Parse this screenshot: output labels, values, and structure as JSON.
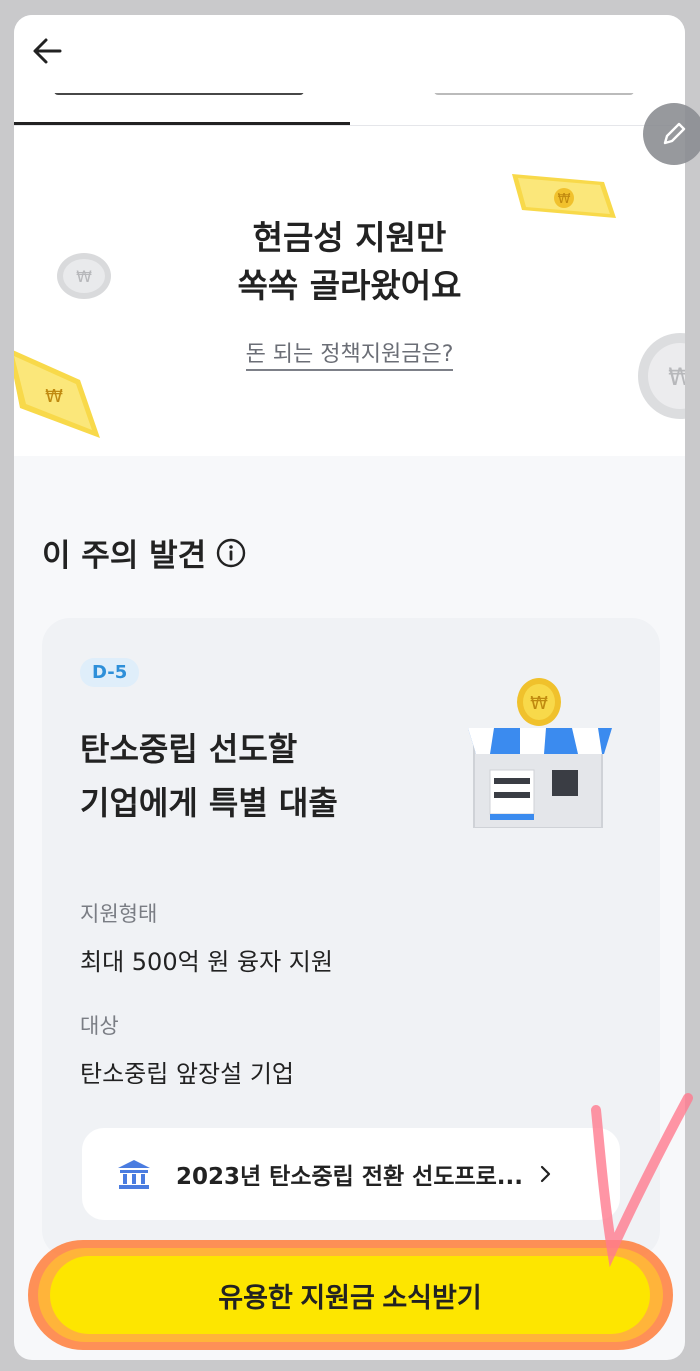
{
  "hero": {
    "title_line1": "현금성 지원만",
    "title_line2": "쏙쏙 골라왔어요",
    "link": "돈 되는 정책지원금은?"
  },
  "section": {
    "title": "이 주의 발견"
  },
  "card": {
    "badge": "D-5",
    "title_line1": "탄소중립 선도할",
    "title_line2": "기업에게 특별 대출",
    "support_type_label": "지원형태",
    "support_type_value": "최대 500억 원 융자 지원",
    "target_label": "대상",
    "target_value": "탄소중립 앞장설 기업",
    "program_link": "2023년 탄소중립 전환 선도프로..."
  },
  "cta": {
    "label": "유용한 지원금 소식받기"
  },
  "colors": {
    "cta_yellow": "#fde600",
    "badge_blue": "#2d8fd9",
    "highlight_orange": "#ff7e3a"
  },
  "icons": [
    "back-arrow-icon",
    "info-icon",
    "bank-icon",
    "chevron-right-icon",
    "pencil-icon",
    "shop-illustration",
    "money-bill-icon",
    "coin-icon"
  ]
}
